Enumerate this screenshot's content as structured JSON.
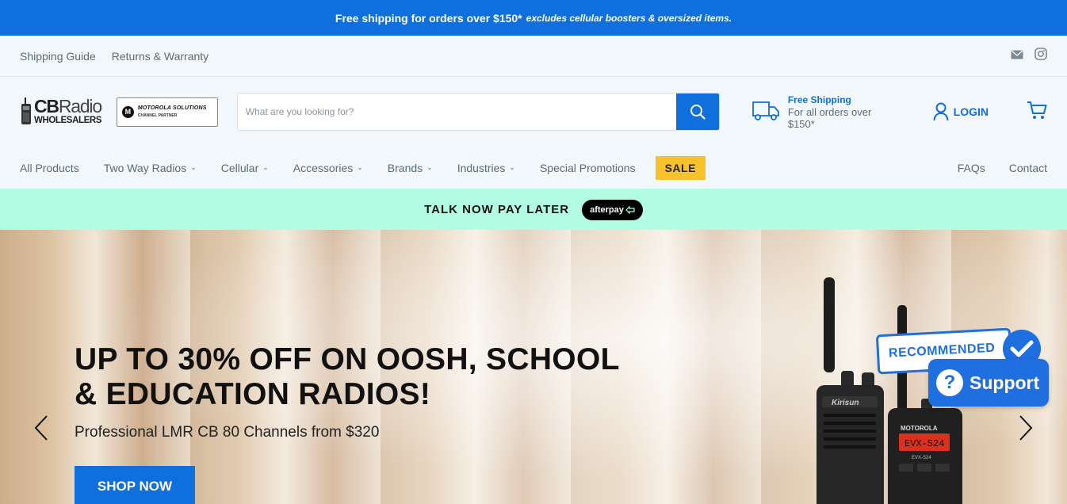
{
  "announcement": {
    "main": "Free shipping for orders over $150*",
    "note": "excludes cellular boosters & oversized items."
  },
  "utility_links": [
    "Shipping Guide",
    "Returns & Warranty"
  ],
  "social_icons": [
    "mail-icon",
    "instagram-icon"
  ],
  "logo": {
    "line1_a": "CB",
    "line1_b": "Radio",
    "line2": "WHOLESALERS"
  },
  "partner_badge": {
    "brand": "MOTOROLA SOLUTIONS",
    "sub": "CHANNEL PARTNER",
    "mark": "M"
  },
  "search": {
    "placeholder": "What are you looking for?",
    "value": ""
  },
  "shipping_promo": {
    "title": "Free Shipping",
    "subtitle": "For all orders over $150*"
  },
  "account": {
    "login_label": "LOGIN"
  },
  "nav": {
    "items": [
      {
        "label": "All Products",
        "dropdown": false
      },
      {
        "label": "Two Way Radios",
        "dropdown": true
      },
      {
        "label": "Cellular",
        "dropdown": true
      },
      {
        "label": "Accessories",
        "dropdown": true
      },
      {
        "label": "Brands",
        "dropdown": true
      },
      {
        "label": "Industries",
        "dropdown": true
      },
      {
        "label": "Special Promotions",
        "dropdown": false
      }
    ],
    "sale_label": "SALE",
    "right": [
      "FAQs",
      "Contact"
    ]
  },
  "afterpay": {
    "text": "TALK NOW PAY LATER",
    "badge": "afterpay"
  },
  "hero": {
    "headline_line1": "UP TO 30% OFF ON OOSH, SCHOOL",
    "headline_line2": "& EDUCATION RADIOS!",
    "subtitle": "Professional LMR CB 80 Channels from $320",
    "cta": "SHOP NOW",
    "radio1_brand": "Kirisun",
    "radio2_brand": "MOTOROLA",
    "radio2_display": "EVX-S24",
    "radio2_model": "EVX-S24"
  },
  "widgets": {
    "recommended": "RECOMMENDED",
    "support": "Support"
  },
  "colors": {
    "brand_blue": "#0f6fdd",
    "sale_yellow": "#f8c22d",
    "afterpay_mint": "#b2fce4"
  }
}
